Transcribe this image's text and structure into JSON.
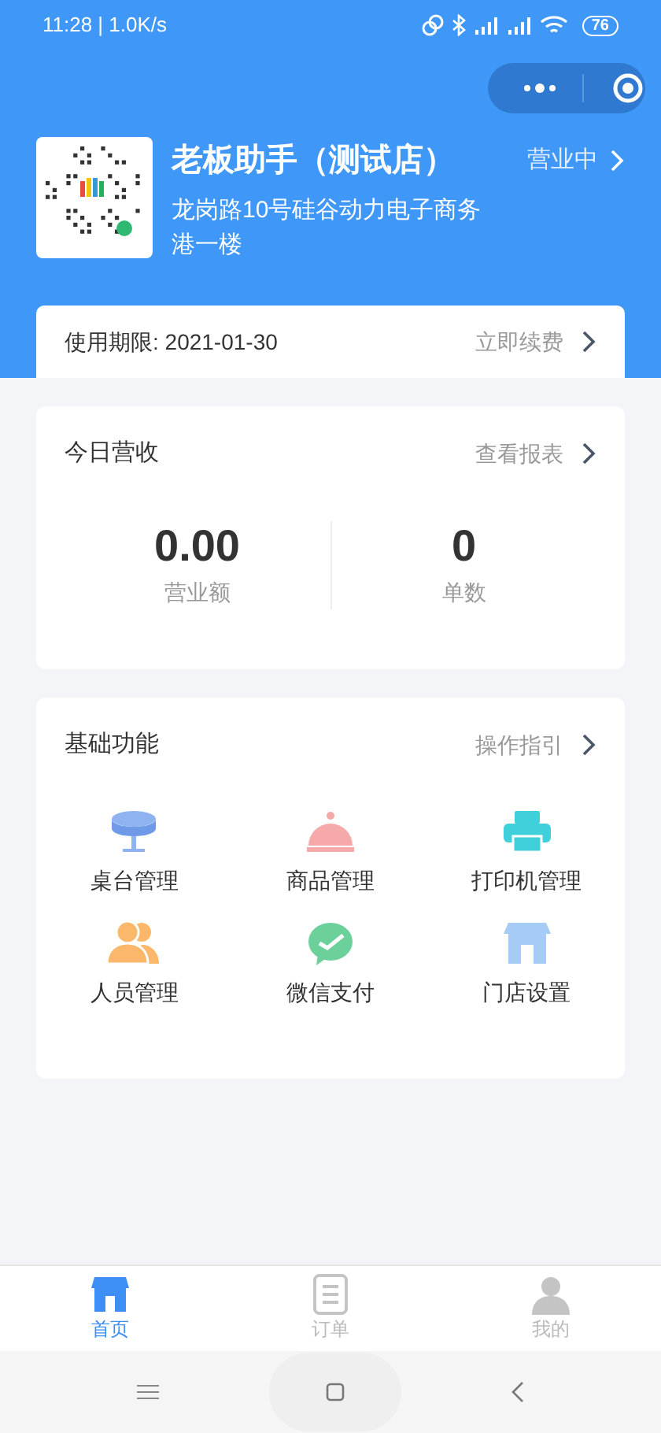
{
  "status_bar": {
    "time": "11:28 | 1.0K/s",
    "battery": "76"
  },
  "store": {
    "name": "老板助手（测试店）",
    "address": "龙岗路10号硅谷动力电子商务港一楼",
    "status": "营业中"
  },
  "subscription": {
    "label": "使用期限: 2021-01-30",
    "action": "立即续费"
  },
  "revenue": {
    "title": "今日营收",
    "action": "查看报表",
    "stats": [
      {
        "value": "0.00",
        "label": "营业额"
      },
      {
        "value": "0",
        "label": "单数"
      }
    ]
  },
  "functions": {
    "title": "基础功能",
    "action": "操作指引",
    "items": [
      {
        "kind": "table",
        "label": "桌台管理"
      },
      {
        "kind": "dish",
        "label": "商品管理"
      },
      {
        "kind": "printer",
        "label": "打印机管理"
      },
      {
        "kind": "people",
        "label": "人员管理"
      },
      {
        "kind": "wechat",
        "label": "微信支付"
      },
      {
        "kind": "store",
        "label": "门店设置"
      }
    ]
  },
  "tabs": [
    {
      "kind": "home",
      "label": "首页",
      "selected": true
    },
    {
      "kind": "orders",
      "label": "订单",
      "selected": false
    },
    {
      "kind": "profile",
      "label": "我的",
      "selected": false
    }
  ]
}
